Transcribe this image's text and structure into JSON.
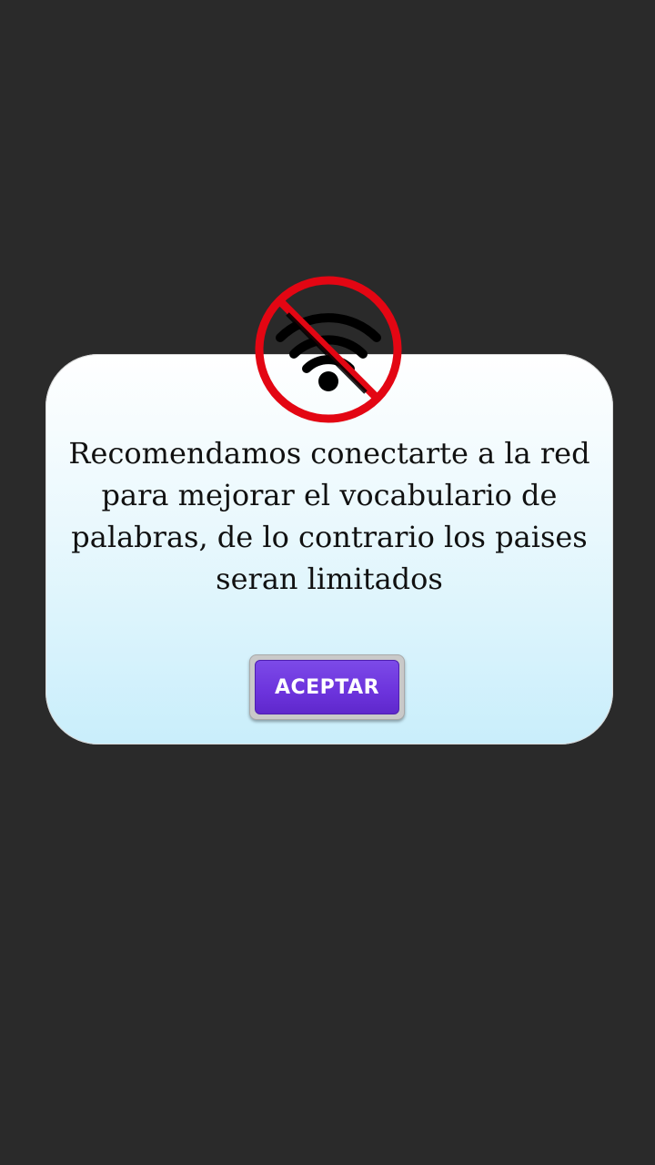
{
  "dialog": {
    "message": "Recomendamos conectarte a la red para mejorar el vocabulario de palabras, de lo contrario los paises seran limitados",
    "accept_label": "ACEPTAR",
    "icon": "no-wifi-icon"
  },
  "colors": {
    "background": "#2a2a2a",
    "button": "#6c33dc",
    "prohibited_sign": "#e30613"
  }
}
